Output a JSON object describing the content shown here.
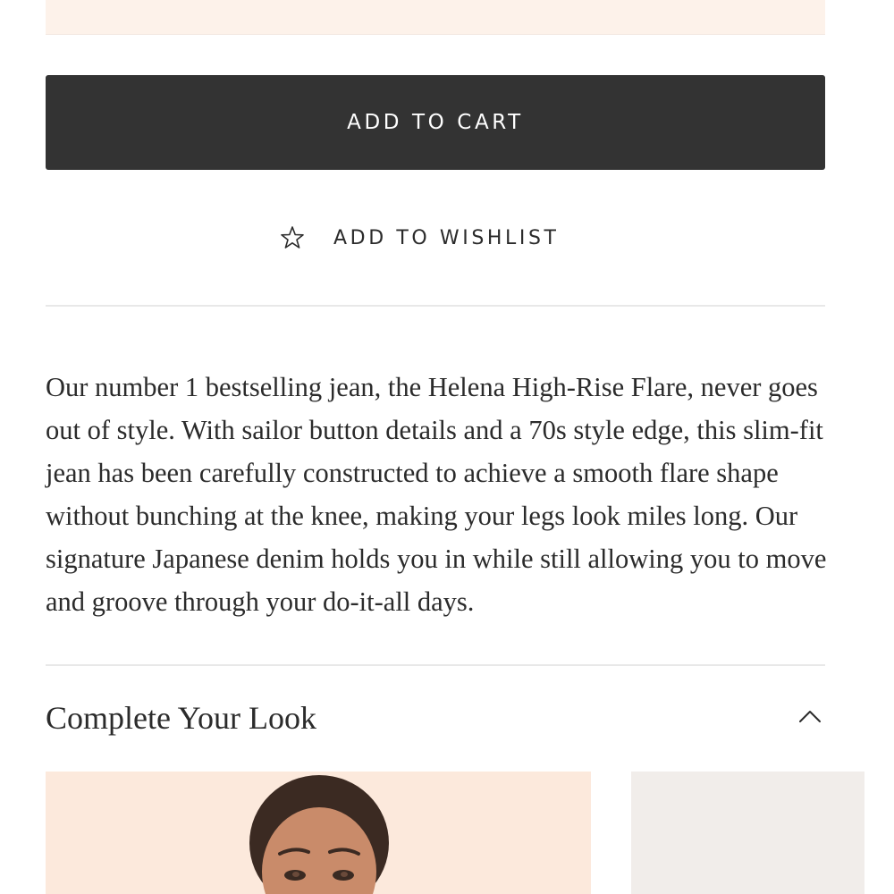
{
  "actions": {
    "add_to_cart_label": "ADD TO CART",
    "wishlist_label": "ADD TO WISHLIST",
    "wishlist_icon": "star-outline-icon"
  },
  "product": {
    "description": "Our number 1 bestselling jean, the Helena High-Rise Flare, never goes out of style. With sailor button details and a 70s style edge, this slim-fit jean has been carefully constructed to achieve a smooth flare shape without bunching at the knee, making your legs look miles long. Our signature Japanese denim holds you in while still allowing you to move and groove through your do-it-all days."
  },
  "complete_your_look": {
    "title": "Complete Your Look",
    "toggle_icon": "chevron-up-icon",
    "expanded": true
  },
  "colors": {
    "button_bg": "#333333",
    "button_text": "#ffffff",
    "text": "#2b2b2b",
    "banner_bg": "#fdf2ea",
    "divider": "#e8e8e8",
    "card_1_bg": "#fce9dc",
    "card_2_bg": "#f1edea"
  }
}
